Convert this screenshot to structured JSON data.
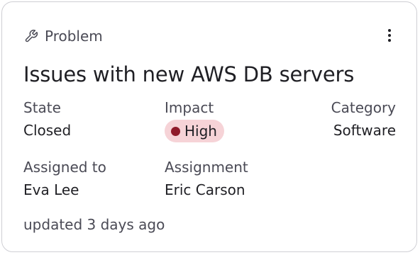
{
  "card": {
    "type_label": "Problem",
    "type_icon": "wrench-icon",
    "title": "Issues with new AWS DB servers",
    "fields": {
      "state": {
        "label": "State",
        "value": "Closed"
      },
      "impact": {
        "label": "Impact",
        "value": "High"
      },
      "category": {
        "label": "Category",
        "value": "Software"
      },
      "assigned_to": {
        "label": "Assigned to",
        "value": "Eva Lee"
      },
      "assignment": {
        "label": "Assignment",
        "value": "Eric Carson"
      }
    },
    "updated": "updated 3 days ago",
    "menu_icon": "more-vertical-icon"
  },
  "colors": {
    "impact_badge_bg": "#f6d3d7",
    "impact_dot": "#8f1a2a",
    "border": "#cfcfd4"
  }
}
